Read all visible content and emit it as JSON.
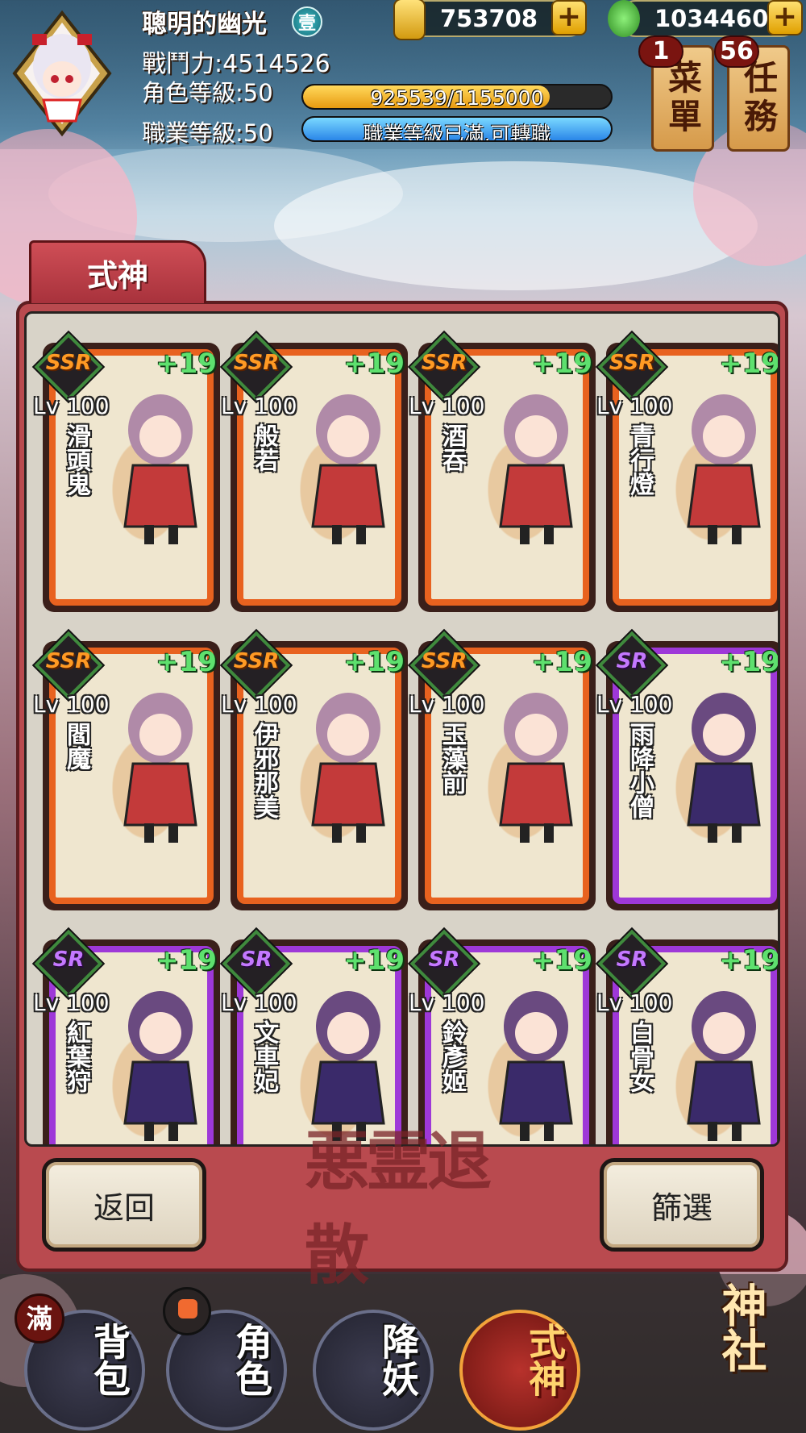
{
  "player": {
    "name": "聰明的幽光",
    "rank_badge": "壹",
    "power_label": "戰鬥力:4514526",
    "char_level_label": "角色等級:50",
    "char_exp_text": "925539/1155000",
    "char_exp_fraction": 0.801,
    "job_level_label": "職業等級:50",
    "job_status_text": "職業等級已滿,可轉職",
    "job_fraction": 1.0
  },
  "currency": {
    "gold": "753708",
    "jade": "1034460"
  },
  "top_menu": {
    "menu_label": "菜單",
    "menu_badge": "1",
    "quest_label": "任務",
    "quest_badge": "56"
  },
  "panel": {
    "tab_label": "式神",
    "back_label": "返回",
    "filter_label": "篩選",
    "emblem_text": "悪霊退散"
  },
  "cards": [
    {
      "rarity": "SSR",
      "plus": "+19",
      "level": "Lv 100",
      "name": "滑頭鬼"
    },
    {
      "rarity": "SSR",
      "plus": "+19",
      "level": "Lv 100",
      "name": "般若"
    },
    {
      "rarity": "SSR",
      "plus": "+19",
      "level": "Lv 100",
      "name": "酒吞"
    },
    {
      "rarity": "SSR",
      "plus": "+19",
      "level": "Lv 100",
      "name": "青行燈"
    },
    {
      "rarity": "SSR",
      "plus": "+19",
      "level": "Lv 100",
      "name": "閻魔"
    },
    {
      "rarity": "SSR",
      "plus": "+19",
      "level": "Lv 100",
      "name": "伊邪那美"
    },
    {
      "rarity": "SSR",
      "plus": "+19",
      "level": "Lv 100",
      "name": "玉藻前"
    },
    {
      "rarity": "SR",
      "plus": "+19",
      "level": "Lv 100",
      "name": "雨降小僧"
    },
    {
      "rarity": "SR",
      "plus": "+19",
      "level": "Lv 100",
      "name": "紅葉狩"
    },
    {
      "rarity": "SR",
      "plus": "+19",
      "level": "Lv 100",
      "name": "文車妃"
    },
    {
      "rarity": "SR",
      "plus": "+19",
      "level": "Lv 100",
      "name": "鈴彥姬"
    },
    {
      "rarity": "SR",
      "plus": "+19",
      "level": "Lv 100",
      "name": "白骨女"
    }
  ],
  "nav": {
    "bag": "背包",
    "bag_badge": "滿",
    "role": "角色",
    "subdue": "降妖",
    "shikigami": "式神",
    "shrine": "神社"
  },
  "colors": {
    "ssr_border": "#e8621f",
    "sr_border": "#9e38d8",
    "plus_green": "#5ee06e",
    "panel_red": "#b94a4f"
  }
}
